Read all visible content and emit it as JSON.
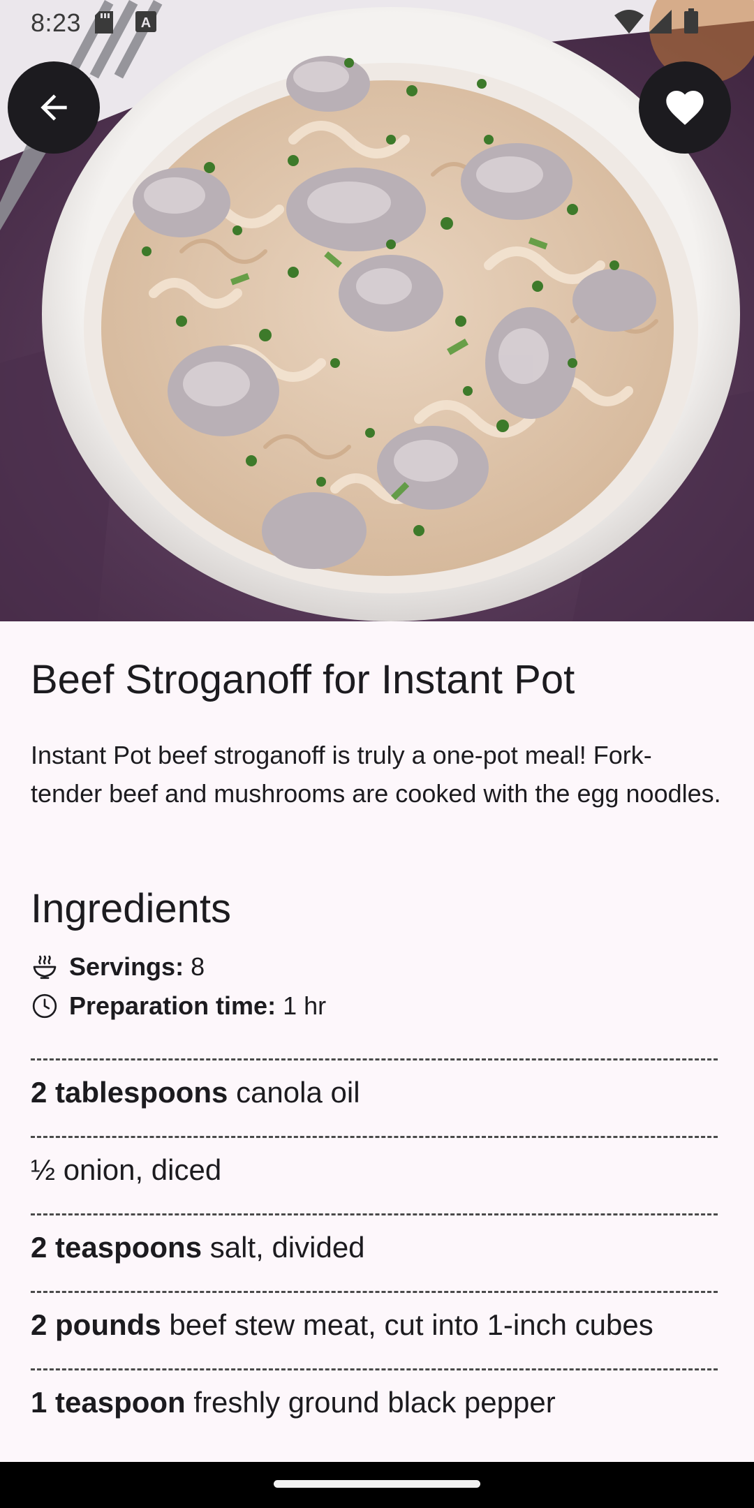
{
  "status_bar": {
    "time": "8:23",
    "left_icons": [
      "sd-card-icon",
      "keyboard-a-icon"
    ],
    "right_icons": [
      "wifi-icon",
      "signal-icon",
      "battery-icon"
    ]
  },
  "hero": {
    "icon": "beef-stroganoff-photo"
  },
  "actions": {
    "back_icon": "arrow-left-icon",
    "favorite_icon": "heart-icon"
  },
  "recipe": {
    "title": "Beef Stroganoff for Instant Pot",
    "description": "Instant Pot beef stroganoff is truly a one-pot meal! Fork-tender beef and mushrooms are cooked with the egg noodles.",
    "ingredients_heading": "Ingredients",
    "servings": {
      "label": "Servings:",
      "value": "8",
      "icon": "bowl-steam-icon"
    },
    "prep_time": {
      "label": "Preparation time:",
      "value": "1 hr",
      "icon": "clock-icon"
    },
    "ingredients": [
      {
        "qty": "2 tablespoons",
        "text": "canola oil"
      },
      {
        "qty": "",
        "text": "½ onion, diced"
      },
      {
        "qty": "2 teaspoons",
        "text": "salt, divided"
      },
      {
        "qty": "2 pounds",
        "text": "beef stew meat, cut into 1-inch cubes"
      },
      {
        "qty": "1 teaspoon",
        "text": "freshly ground black pepper"
      }
    ]
  },
  "colors": {
    "background": "#fdf7fb",
    "text": "#1c1b1f",
    "fab": "#1c1b1f",
    "napkin": "#5a3a5c"
  }
}
